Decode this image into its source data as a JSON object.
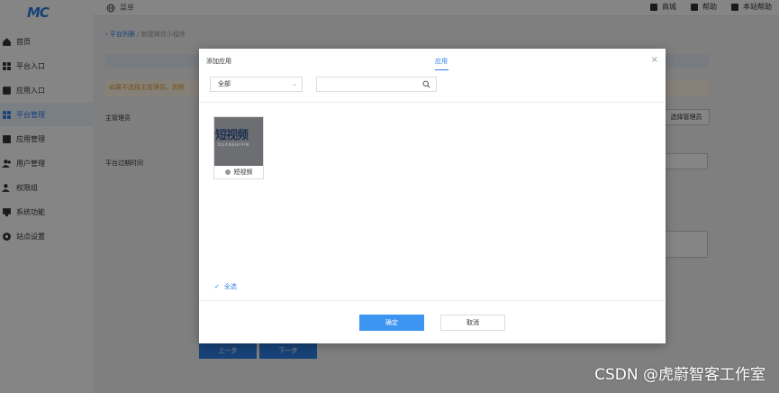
{
  "logo": "MC",
  "sidebar": {
    "items": [
      {
        "label": "首页",
        "icon": "home-icon"
      },
      {
        "label": "平台入口",
        "icon": "grid-icon"
      },
      {
        "label": "应用入口",
        "icon": "apps-icon"
      },
      {
        "label": "平台管理",
        "icon": "platform-icon",
        "active": true
      },
      {
        "label": "应用管理",
        "icon": "app-manage-icon"
      },
      {
        "label": "用户管理",
        "icon": "users-icon"
      },
      {
        "label": "权限组",
        "icon": "permission-icon"
      },
      {
        "label": "系统功能",
        "icon": "monitor-icon"
      },
      {
        "label": "站点设置",
        "icon": "settings-icon"
      }
    ]
  },
  "topbar": {
    "menu": "菜单",
    "right": [
      {
        "label": "商城"
      },
      {
        "label": "帮助"
      },
      {
        "label": "本站帮助"
      }
    ]
  },
  "page": {
    "breadcrumb_back": "平台列表",
    "breadcrumb_sep": "/",
    "breadcrumb_current": "新建微信小程序",
    "warning": "如果不选择主管理员，则默",
    "admin_label": "主管理员",
    "admin_button": "选择管理员",
    "expire_label": "平台过期时间",
    "prev_button": "上一步",
    "next_button": "下一步"
  },
  "modal": {
    "title": "添加应用",
    "tab": "应用",
    "close": "×",
    "filter_value": "全部",
    "search_placeholder": "",
    "apps": [
      {
        "thumb_text": "短视频",
        "thumb_sub": "DUANSHIPIN",
        "name": "短视频"
      }
    ],
    "select_all": "全选",
    "ok_button": "确定",
    "cancel_button": "取消"
  },
  "watermark": "CSDN @虎蔚智客工作室",
  "colors": {
    "accent": "#2d7fe6",
    "warning": "#e09c30"
  }
}
